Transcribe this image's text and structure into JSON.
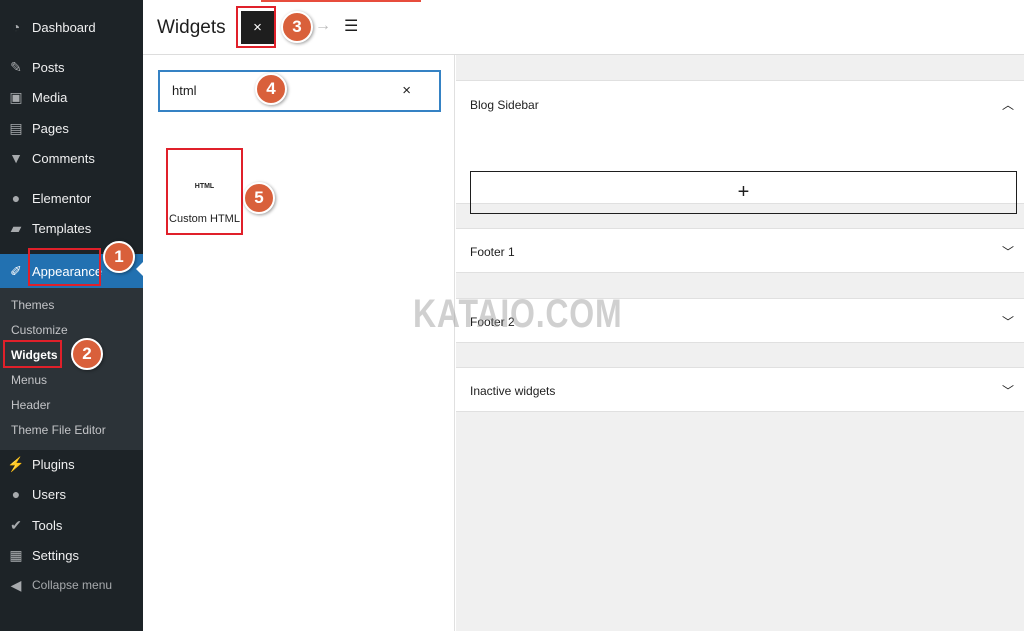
{
  "sidebar": {
    "items": [
      {
        "label": "Dashboard",
        "icon": "dashboard-icon"
      },
      {
        "label": "Posts",
        "icon": "pin-icon"
      },
      {
        "label": "Media",
        "icon": "media-icon"
      },
      {
        "label": "Pages",
        "icon": "pages-icon"
      },
      {
        "label": "Comments",
        "icon": "comment-icon"
      },
      {
        "label": "Elementor",
        "icon": "elementor-icon"
      },
      {
        "label": "Templates",
        "icon": "folder-icon"
      },
      {
        "label": "Appearance",
        "icon": "brush-icon"
      },
      {
        "label": "Plugins",
        "icon": "plug-icon"
      },
      {
        "label": "Users",
        "icon": "user-icon"
      },
      {
        "label": "Tools",
        "icon": "wrench-icon"
      },
      {
        "label": "Settings",
        "icon": "settings-icon"
      },
      {
        "label": "Collapse menu",
        "icon": "collapse-icon"
      }
    ],
    "submenu": [
      "Themes",
      "Customize",
      "Widgets",
      "Menus",
      "Header",
      "Theme File Editor"
    ]
  },
  "header": {
    "title": "Widgets",
    "close": "×",
    "redo": "→",
    "list_view": "☰"
  },
  "inserter": {
    "search_value": "html",
    "clear": "×",
    "block_icon": "HTML",
    "block_label": "Custom HTML"
  },
  "areas": [
    {
      "title": "Blog Sidebar",
      "expanded": true,
      "add": "+"
    },
    {
      "title": "Footer 1"
    },
    {
      "title": "Footer 2"
    },
    {
      "title": "Inactive widgets"
    }
  ],
  "annotations": [
    "1",
    "2",
    "3",
    "4",
    "5"
  ],
  "watermark": "KATAIO.COM",
  "colors": {
    "accent": "#2271b1",
    "sidebar": "#1d2327",
    "annotation": "#d9603b",
    "highlight": "#e0202a"
  }
}
